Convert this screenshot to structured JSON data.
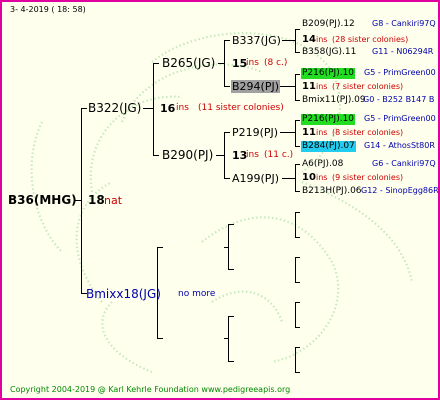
{
  "header": {
    "date": "3-   4-2019  ( 18:  58)"
  },
  "footer": {
    "copyright": "Copyright 2004-2019 @ Karl Kehrle Foundation   www.pedigreeapis.org"
  },
  "colors": {
    "frame": "#e000a0",
    "background": "#ffffee",
    "inbreeding": "#cc0000",
    "generation_note": "#0000aa",
    "footer": "#008800",
    "highlight_green": "#22dd22",
    "highlight_grey": "#a0a0a0",
    "highlight_cyan": "#22ccee"
  },
  "root": {
    "name": "B36(MHG)",
    "count": "18",
    "count_unit": "nat"
  },
  "sire": {
    "name": "B322(JG)",
    "count": "16",
    "unit": "ins",
    "note": "(11 sister colonies)"
  },
  "dam": {
    "name": "Bmixx18(JG)",
    "note": "no more"
  },
  "sire_sire": {
    "name": "B265(JG)",
    "count": "15",
    "unit": "ins",
    "note": "(8 c.)"
  },
  "sire_dam": {
    "name": "B290(PJ)",
    "count": "13",
    "unit": "ins",
    "note": "(11 c.)"
  },
  "g3": [
    {
      "name": "B337(JG)"
    },
    {
      "name": "B294(PJ)"
    },
    {
      "name": "P219(PJ)"
    },
    {
      "name": "A199(PJ)"
    }
  ],
  "g4": [
    {
      "name": "B209(PJ).12",
      "info": "G8 - Cankiri97Q",
      "count": "14",
      "unit": "ins",
      "note": "(28 sister colonies)"
    },
    {
      "name": "B358(JG).11",
      "info": "G11 - N06294R"
    },
    {
      "name": "P216(PJ).10",
      "info": "G5 - PrimGreen00",
      "count": "11",
      "unit": "ins",
      "note": "(7 sister colonies)"
    },
    {
      "name": "Bmix11(PJ).09",
      "info": "G0 - B252 B147 B"
    },
    {
      "name": "P216(PJ).10",
      "info": "G5 - PrimGreen00",
      "count": "11",
      "unit": "ins",
      "note": "(8 sister colonies)"
    },
    {
      "name": "B284(PJ).07",
      "info": "G14 - AthosSt80R"
    },
    {
      "name": "A6(PJ).08",
      "info": "G6 - Cankiri97Q",
      "count": "10",
      "unit": "ins",
      "note": "(9 sister colonies)"
    },
    {
      "name": "B213H(PJ).06",
      "info": "G12 - SinopEgg86R"
    }
  ]
}
